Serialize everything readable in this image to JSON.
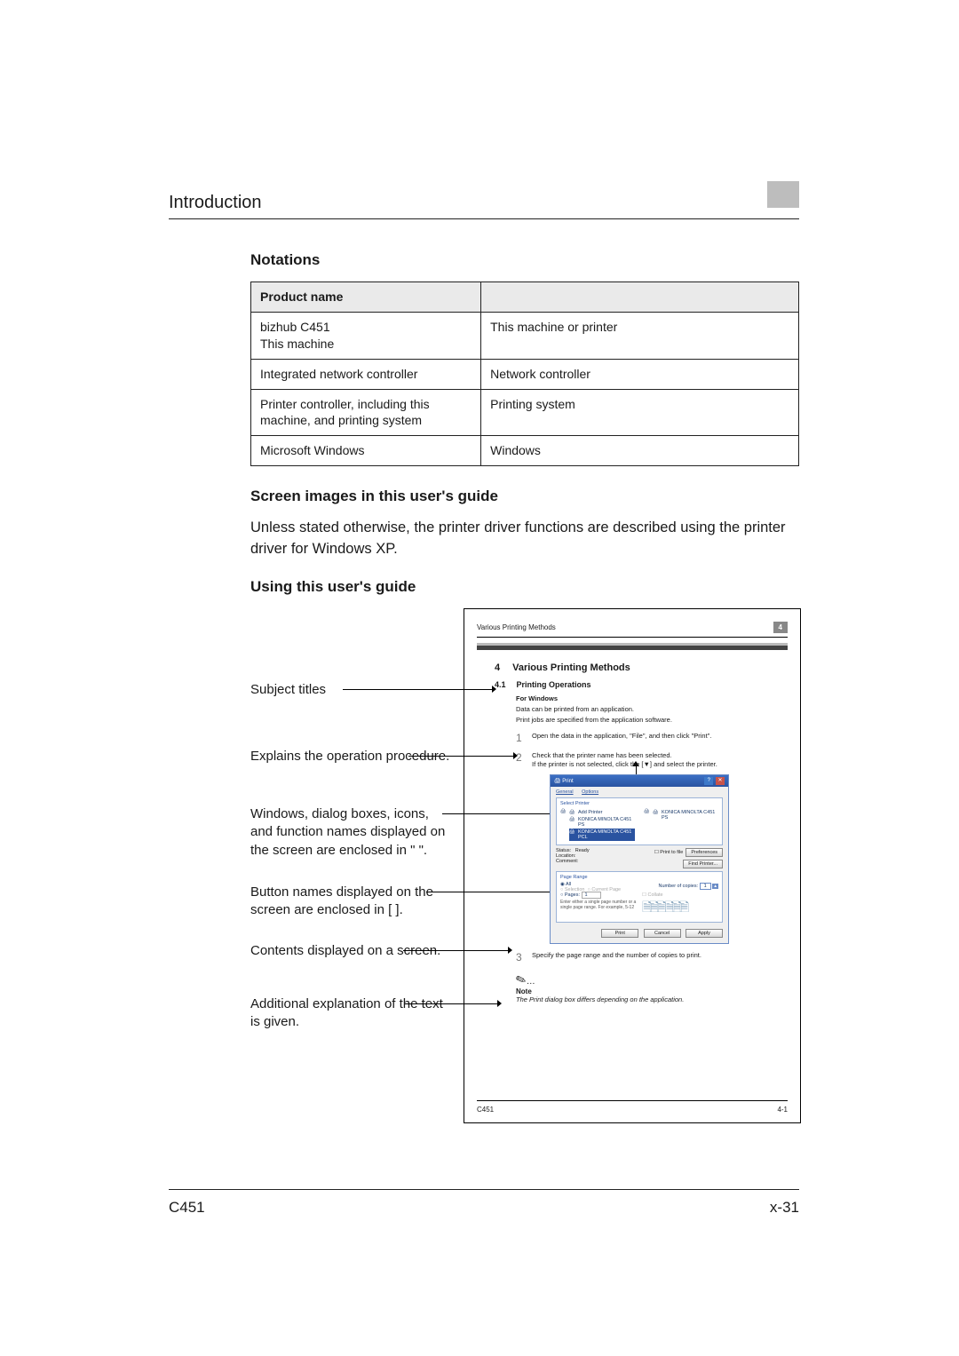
{
  "header": {
    "title": "Introduction"
  },
  "notations": {
    "heading": "Notations",
    "col1_header": "Product name",
    "rows": [
      {
        "name": "bizhub C451\nThis machine",
        "alias": "This machine or printer"
      },
      {
        "name": "Integrated network controller",
        "alias": "Network controller"
      },
      {
        "name": "Printer controller, including this machine, and printing system",
        "alias": "Printing system"
      },
      {
        "name": "Microsoft Windows",
        "alias": "Windows"
      }
    ]
  },
  "section_screen": {
    "heading": "Screen images in this user's guide",
    "body": "Unless stated otherwise, the printer driver functions are described using the printer driver for Windows XP."
  },
  "section_using": {
    "heading": "Using this user's guide"
  },
  "callouts": {
    "c1": "Subject titles",
    "c2": "Explains the operation procedure.",
    "c3": "Windows, dialog boxes, icons, and function names displayed on the screen are enclosed in \" \".",
    "c4": "Button names displayed on the screen are enclosed in [  ].",
    "c5": "Contents displayed on a screen.",
    "c6": "Additional explanation of the text is given."
  },
  "mini": {
    "header_left": "Various Printing Methods",
    "header_right": "4",
    "chap_num": "4",
    "chap_title": "Various Printing Methods",
    "sect_num": "4.1",
    "sect_title": "Printing Operations",
    "for_windows": "For Windows",
    "p1": "Data can be printed from an application.",
    "p2": "Print jobs are specified from the application software.",
    "step1": "Open the data in the application, \"File\", and then click \"Print\".",
    "step2a": "Check that the printer name has been selected.",
    "step2b": "If the printer is not selected, click the [▼] and select the printer.",
    "step3": "Specify the page range and the number of copies to print.",
    "note_label": "Note",
    "note_text": "The Print dialog box differs depending on the application.",
    "footer_left": "C451",
    "footer_right": "4-1"
  },
  "dialog": {
    "title": "Print",
    "tab1": "General",
    "tab2": "Options",
    "group_select": "Select Printer",
    "printer1": "Add Printer",
    "printer2": "KONICA MINOLTA C451 PS",
    "printer3": "KONICA MINOLTA C451 PCL",
    "printer2b": "KONICA MINOLTA C451 PS",
    "status_lbl": "Status:",
    "status_val": "Ready",
    "location_lbl": "Location:",
    "comment_lbl": "Comment:",
    "print_to_file": "Print to file",
    "preferences": "Preferences",
    "find_printer": "Find Printer...",
    "group_range": "Page Range",
    "opt_all": "All",
    "opt_selection": "Selection",
    "opt_current": "Current Page",
    "opt_pages": "Pages:",
    "pages_val": "1",
    "copies_lbl": "Number of copies:",
    "copies_val": "1",
    "collate": "Collate",
    "range_hint": "Enter either a single page number or a single page range. For example, 5-12",
    "btn_print": "Print",
    "btn_cancel": "Cancel",
    "btn_apply": "Apply"
  },
  "footer": {
    "left": "C451",
    "right": "x-31"
  }
}
